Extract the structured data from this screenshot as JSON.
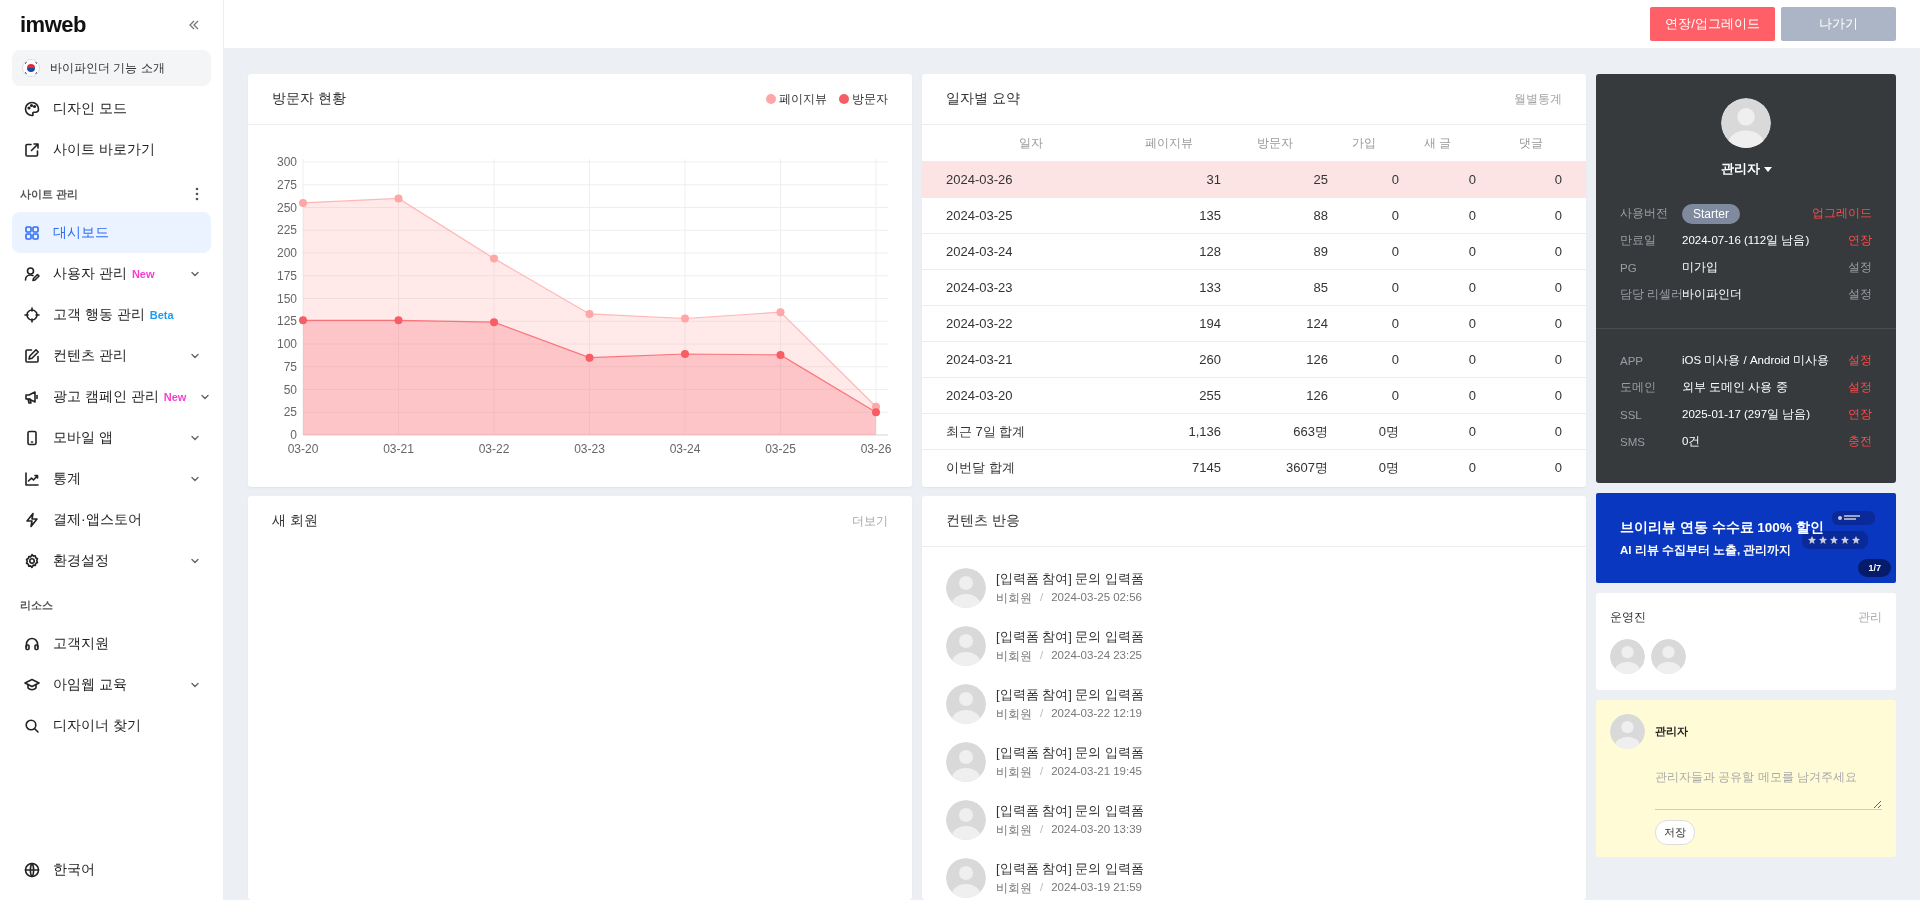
{
  "sidebar": {
    "logo": "imweb",
    "intro": "바이파인더 기능 소개",
    "top_items": [
      {
        "label": "디자인 모드",
        "expandable": false,
        "selected": false
      },
      {
        "label": "사이트 바로가기",
        "expandable": false,
        "selected": false
      }
    ],
    "sections": [
      {
        "title": "사이트 관리",
        "items": [
          {
            "label": "대시보드",
            "expandable": false,
            "selected": true
          },
          {
            "label": "사용자 관리",
            "badge": "New",
            "color": "#f63fcf",
            "expandable": true,
            "selected": false
          },
          {
            "label": "고객 행동 관리",
            "badge": "Beta",
            "color": "#1d9cf0",
            "expandable": false,
            "selected": false
          },
          {
            "label": "컨텐츠 관리",
            "expandable": true,
            "selected": false
          },
          {
            "label": "광고 캠페인 관리",
            "badge": "New",
            "color": "#f63fcf",
            "expandable": true,
            "selected": false
          },
          {
            "label": "모바일 앱",
            "expandable": true,
            "selected": false
          },
          {
            "label": "통계",
            "expandable": true,
            "selected": false
          },
          {
            "label": "결제·앱스토어",
            "expandable": false,
            "selected": false
          },
          {
            "label": "환경설정",
            "expandable": true,
            "selected": false
          }
        ]
      },
      {
        "title": "리소스",
        "items": [
          {
            "label": "고객지원",
            "expandable": false,
            "selected": false
          },
          {
            "label": "아임웹 교육",
            "expandable": true,
            "selected": false
          },
          {
            "label": "디자이너 찾기",
            "expandable": false,
            "selected": false
          }
        ]
      }
    ],
    "language": "한국어"
  },
  "top_bar": {
    "buttons": [
      {
        "label": "연장/업그레이드",
        "kind": "primary"
      },
      {
        "label": "나가기",
        "kind": "secondary"
      }
    ]
  },
  "visitor_chart": {
    "title": "방문자 현황",
    "chart_data": {
      "type": "area",
      "grid": true,
      "categories": [
        "03-20",
        "03-21",
        "03-22",
        "03-23",
        "03-24",
        "03-25",
        "03-26"
      ],
      "ylim": [
        0,
        300
      ],
      "yticks": [
        0,
        25,
        50,
        75,
        100,
        125,
        150,
        175,
        200,
        225,
        250,
        275,
        300
      ],
      "series": [
        {
          "name": "페이지뷰",
          "color": "#ffa6a6",
          "values": [
            255,
            260,
            194,
            133,
            128,
            135,
            31
          ]
        },
        {
          "name": "방문자",
          "color": "#f85c64",
          "values": [
            126,
            126,
            124,
            85,
            89,
            88,
            25
          ]
        }
      ]
    }
  },
  "daily_summary": {
    "title": "일자별 요약",
    "link": "월별통계",
    "columns": [
      "일자",
      "페이지뷰",
      "방문자",
      "가입",
      "새 글",
      "댓글"
    ],
    "rows": [
      {
        "cells": [
          "2024-03-26",
          "31",
          "25",
          "0",
          "0",
          "0"
        ],
        "highlighted": true
      },
      {
        "cells": [
          "2024-03-25",
          "135",
          "88",
          "0",
          "0",
          "0"
        ],
        "highlighted": false
      },
      {
        "cells": [
          "2024-03-24",
          "128",
          "89",
          "0",
          "0",
          "0"
        ],
        "highlighted": false
      },
      {
        "cells": [
          "2024-03-23",
          "133",
          "85",
          "0",
          "0",
          "0"
        ],
        "highlighted": false
      },
      {
        "cells": [
          "2024-03-22",
          "194",
          "124",
          "0",
          "0",
          "0"
        ],
        "highlighted": false
      },
      {
        "cells": [
          "2024-03-21",
          "260",
          "126",
          "0",
          "0",
          "0"
        ],
        "highlighted": false
      },
      {
        "cells": [
          "2024-03-20",
          "255",
          "126",
          "0",
          "0",
          "0"
        ],
        "highlighted": false
      },
      {
        "cells": [
          "최근 7일 합계",
          "1,136",
          "663명",
          "0명",
          "0",
          "0"
        ],
        "highlighted": false
      },
      {
        "cells": [
          "이번달 합계",
          "7145",
          "3607명",
          "0명",
          "0",
          "0"
        ],
        "highlighted": false
      }
    ]
  },
  "profile": {
    "name": "관리자",
    "groups": [
      [
        {
          "label": "사용버전",
          "value": "Starter",
          "kind": "badge",
          "action": "업그레이드",
          "emphasis": true
        },
        {
          "label": "만료일",
          "value": "2024-07-16 (112일 남음)",
          "kind": "text",
          "action": "연장",
          "emphasis": true
        },
        {
          "label": "PG",
          "value": "미가입",
          "kind": "text",
          "action": "설정",
          "emphasis": false
        },
        {
          "label": "담당 리셀러",
          "value": "바이파인더",
          "kind": "text",
          "action": "설정",
          "emphasis": false
        }
      ],
      [
        {
          "label": "APP",
          "value": "iOS 미사용 / Android 미사용",
          "kind": "text",
          "action": "설정",
          "emphasis": true
        },
        {
          "label": "도메인",
          "value": "외부 도메인 사용 중",
          "kind": "text",
          "action": "설정",
          "emphasis": true
        },
        {
          "label": "SSL",
          "value": "2025-01-17 (297일 남음)",
          "kind": "text",
          "action": "연장",
          "emphasis": true
        },
        {
          "label": "SMS",
          "value": "0건",
          "kind": "text",
          "action": "충전",
          "emphasis": true
        }
      ]
    ]
  },
  "banner": {
    "title": "브이리뷰 연동 수수료 100% 할인",
    "subtitle": "AI 리뷰 수집부터 노출, 관리까지",
    "pager": "1/7"
  },
  "staff": {
    "title": "운영진",
    "link": "관리",
    "members": [
      {
        "kind": "avatar"
      },
      {
        "kind": "avatar"
      }
    ]
  },
  "memo": {
    "author": "관리자",
    "placeholder": "관리자들과 공유할 메모를 남겨주세요",
    "button": "저장"
  },
  "new_members": {
    "title": "새 회원",
    "link": "더보기"
  },
  "content_reactions": {
    "title": "컨텐츠 반응",
    "separator": "/",
    "items": [
      {
        "title": "[입력폼 참여] 문의 입력폼",
        "author": "비회원",
        "date": "2024-03-25 02:56"
      },
      {
        "title": "[입력폼 참여] 문의 입력폼",
        "author": "비회원",
        "date": "2024-03-24 23:25"
      },
      {
        "title": "[입력폼 참여] 문의 입력폼",
        "author": "비회원",
        "date": "2024-03-22 12:19"
      },
      {
        "title": "[입력폼 참여] 문의 입력폼",
        "author": "비회원",
        "date": "2024-03-21 19:45"
      },
      {
        "title": "[입력폼 참여] 문의 입력폼",
        "author": "비회원",
        "date": "2024-03-20 13:39"
      },
      {
        "title": "[입력폼 참여] 문의 입력폼",
        "author": "비회원",
        "date": "2024-03-19 21:59"
      }
    ]
  }
}
